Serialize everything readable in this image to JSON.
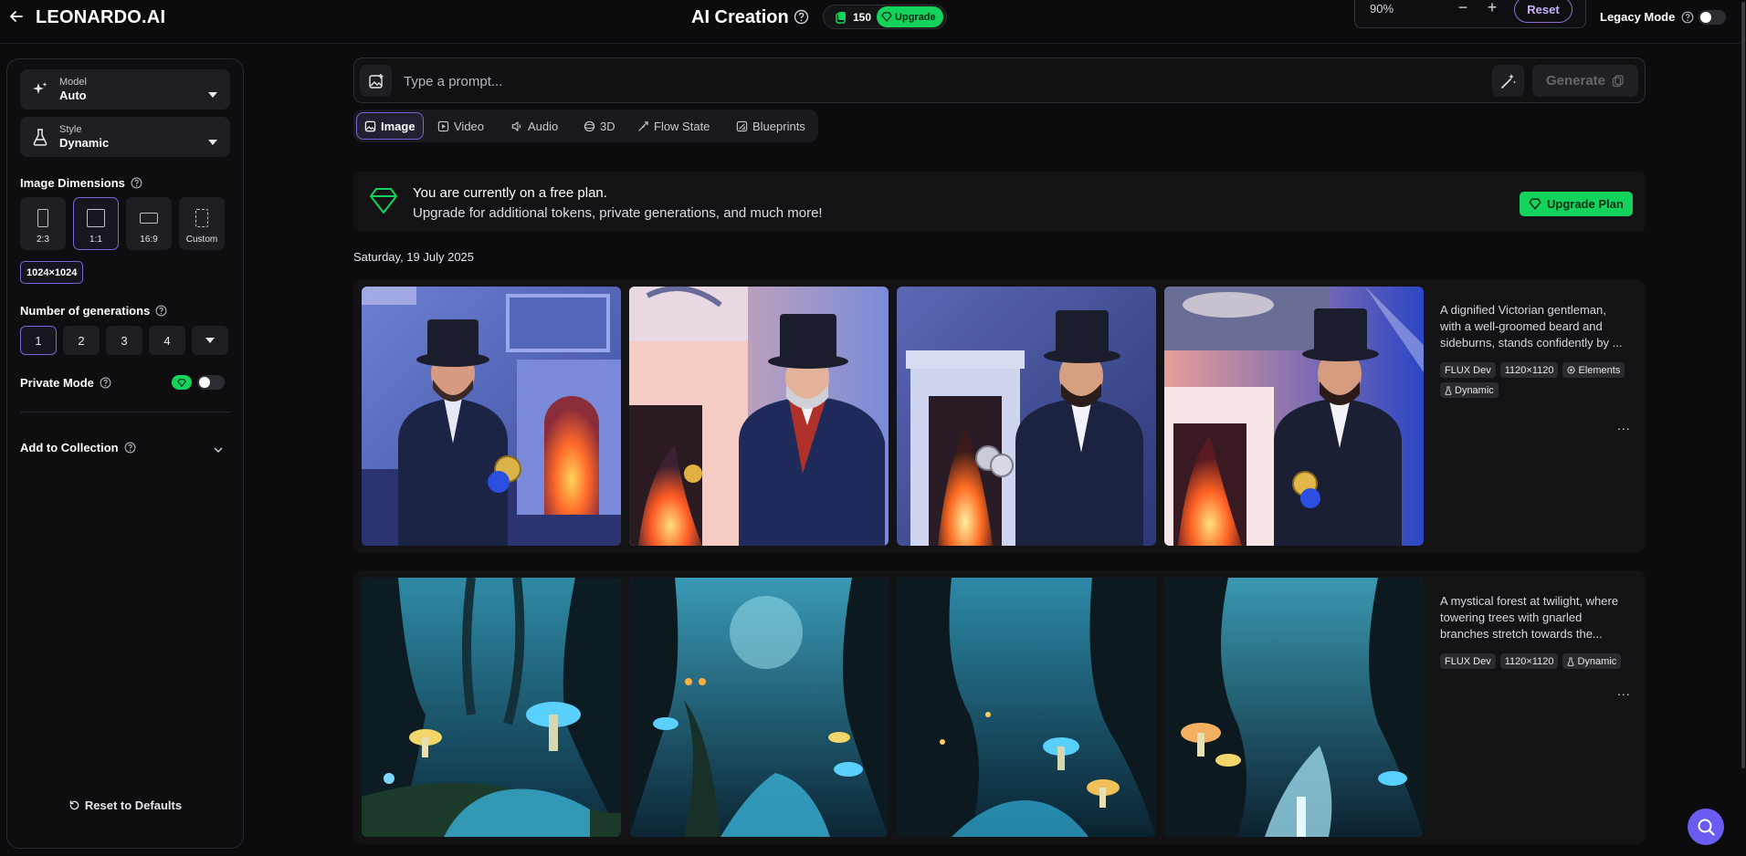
{
  "header": {
    "logo": "LEONARDO.AI",
    "title": "AI Creation",
    "token_count": "150",
    "upgrade_label": "Upgrade",
    "zoom": "90%",
    "reset_label": "Reset",
    "legacy_mode_label": "Legacy Mode"
  },
  "sidebar": {
    "model_label": "Model",
    "model_value": "Auto",
    "style_label": "Style",
    "style_value": "Dynamic",
    "dimensions_label": "Image Dimensions",
    "dimensions": [
      {
        "label": "2:3"
      },
      {
        "label": "1:1"
      },
      {
        "label": "16:9"
      },
      {
        "label": "Custom"
      }
    ],
    "resolution": "1024×1024",
    "generations_label": "Number of generations",
    "generations": [
      "1",
      "2",
      "3",
      "4"
    ],
    "private_mode_label": "Private Mode",
    "collection_label": "Add to Collection",
    "reset_defaults_label": "Reset to Defaults"
  },
  "prompt": {
    "placeholder": "Type a prompt...",
    "generate_label": "Generate"
  },
  "modes": [
    {
      "label": "Image",
      "icon": "image-icon"
    },
    {
      "label": "Video",
      "icon": "video-icon"
    },
    {
      "label": "Audio",
      "icon": "audio-icon"
    },
    {
      "label": "3D",
      "icon": "3d-icon"
    },
    {
      "label": "Flow State",
      "icon": "flow-icon"
    },
    {
      "label": "Blueprints",
      "icon": "blueprint-icon"
    }
  ],
  "banner": {
    "line1": "You are currently on a free plan.",
    "line2": "Upgrade for additional tokens, private generations, and much more!",
    "button": "Upgrade Plan"
  },
  "feed": {
    "date": "Saturday, 19 July 2025",
    "generations": [
      {
        "description_lines": [
          "A dignified Victorian gentleman,",
          "with a well-groomed beard and",
          "sideburns, stands confidently by ..."
        ],
        "tags": [
          "FLUX Dev",
          "1120×1120",
          "Elements",
          "Dynamic"
        ],
        "more": "..."
      },
      {
        "description_lines": [
          "A mystical forest at twilight, where",
          "towering trees with gnarled",
          "branches stretch towards the..."
        ],
        "tags": [
          "FLUX Dev",
          "1120×1120",
          "Dynamic"
        ],
        "more": "..."
      }
    ]
  },
  "colors": {
    "accent_green": "#14d35c",
    "accent_purple": "#7e64d8",
    "background": "#0c0c0e"
  }
}
